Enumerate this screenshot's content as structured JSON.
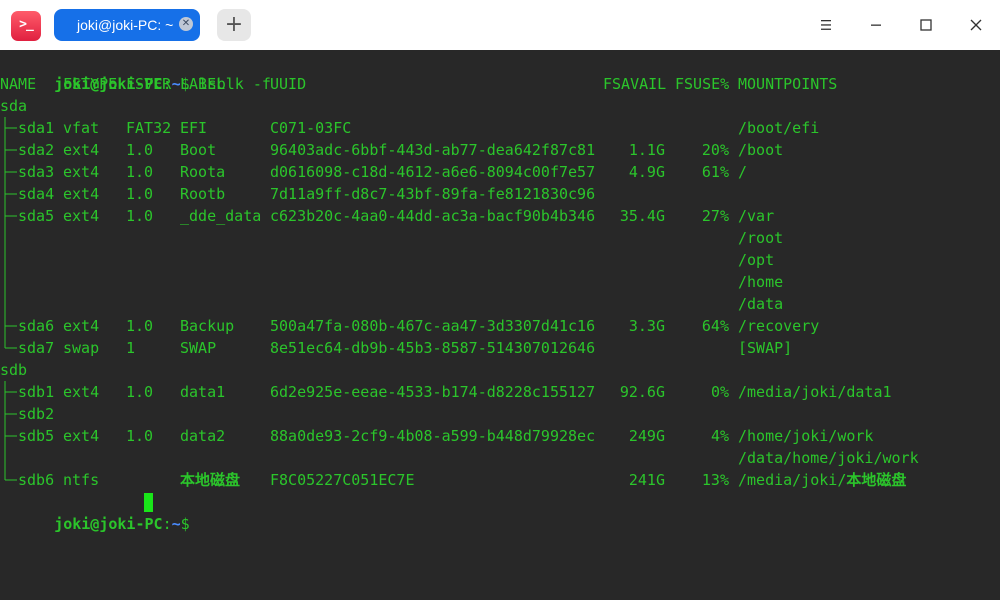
{
  "window": {
    "tab_title": "joki@joki-PC: ~",
    "new_tab_label": "+",
    "app_icon_glyph": ">_",
    "icons": [
      "terminal-app-icon",
      "close-tab-icon",
      "plus-icon",
      "menu-icon",
      "minimize-icon",
      "maximize-icon",
      "close-icon"
    ]
  },
  "colors": {
    "terminal_bg": "#282828",
    "text_green": "#2bc52b",
    "path_blue": "#4a8cff",
    "tab_blue": "#1670e8",
    "cursor": "#19e619"
  },
  "prompt": {
    "user_host": "joki@joki-PC",
    "colon": ":",
    "path": "~",
    "symbol": "$"
  },
  "command": "lsblk -f",
  "headers": {
    "name": "NAME",
    "fstype": "FSTYPE",
    "fsver": "FSVER",
    "label": "LABEL",
    "uuid": "UUID",
    "fsavail": "FSAVAIL",
    "fsuse": "FSUSE%",
    "mountpoints": "MOUNTPOINTS"
  },
  "rows": [
    {
      "name": "sda",
      "fstype": "",
      "fsver": "",
      "label": "",
      "uuid": "",
      "fsavail": "",
      "fsuse": "",
      "mount": ""
    },
    {
      "name": "sda1",
      "fstype": "vfat",
      "fsver": "FAT32",
      "label": "EFI",
      "uuid": "C071-03FC",
      "fsavail": "",
      "fsuse": "",
      "mount": "/boot/efi"
    },
    {
      "name": "sda2",
      "fstype": "ext4",
      "fsver": "1.0",
      "label": "Boot",
      "uuid": "96403adc-6bbf-443d-ab77-dea642f87c81",
      "fsavail": "1.1G",
      "fsuse": "20%",
      "mount": "/boot"
    },
    {
      "name": "sda3",
      "fstype": "ext4",
      "fsver": "1.0",
      "label": "Roota",
      "uuid": "d0616098-c18d-4612-a6e6-8094c00f7e57",
      "fsavail": "4.9G",
      "fsuse": "61%",
      "mount": "/"
    },
    {
      "name": "sda4",
      "fstype": "ext4",
      "fsver": "1.0",
      "label": "Rootb",
      "uuid": "7d11a9ff-d8c7-43bf-89fa-fe8121830c96",
      "fsavail": "",
      "fsuse": "",
      "mount": ""
    },
    {
      "name": "sda5",
      "fstype": "ext4",
      "fsver": "1.0",
      "label": "_dde_data",
      "uuid": "c623b20c-4aa0-44dd-ac3a-bacf90b4b346",
      "fsavail": "35.4G",
      "fsuse": "27%",
      "mount": "/var"
    },
    {
      "name": "",
      "fstype": "",
      "fsver": "",
      "label": "",
      "uuid": "",
      "fsavail": "",
      "fsuse": "",
      "mount": "/root"
    },
    {
      "name": "",
      "fstype": "",
      "fsver": "",
      "label": "",
      "uuid": "",
      "fsavail": "",
      "fsuse": "",
      "mount": "/opt"
    },
    {
      "name": "",
      "fstype": "",
      "fsver": "",
      "label": "",
      "uuid": "",
      "fsavail": "",
      "fsuse": "",
      "mount": "/home"
    },
    {
      "name": "",
      "fstype": "",
      "fsver": "",
      "label": "",
      "uuid": "",
      "fsavail": "",
      "fsuse": "",
      "mount": "/data"
    },
    {
      "name": "sda6",
      "fstype": "ext4",
      "fsver": "1.0",
      "label": "Backup",
      "uuid": "500a47fa-080b-467c-aa47-3d3307d41c16",
      "fsavail": "3.3G",
      "fsuse": "64%",
      "mount": "/recovery"
    },
    {
      "name": "sda7",
      "fstype": "swap",
      "fsver": "1",
      "label": "SWAP",
      "uuid": "8e51ec64-db9b-45b3-8587-514307012646",
      "fsavail": "",
      "fsuse": "",
      "mount": "[SWAP]"
    },
    {
      "name": "sdb",
      "fstype": "",
      "fsver": "",
      "label": "",
      "uuid": "",
      "fsavail": "",
      "fsuse": "",
      "mount": ""
    },
    {
      "name": "sdb1",
      "fstype": "ext4",
      "fsver": "1.0",
      "label": "data1",
      "uuid": "6d2e925e-eeae-4533-b174-d8228c155127",
      "fsavail": "92.6G",
      "fsuse": "0%",
      "mount": "/media/joki/data1"
    },
    {
      "name": "sdb2",
      "fstype": "",
      "fsver": "",
      "label": "",
      "uuid": "",
      "fsavail": "",
      "fsuse": "",
      "mount": ""
    },
    {
      "name": "sdb5",
      "fstype": "ext4",
      "fsver": "1.0",
      "label": "data2",
      "uuid": "88a0de93-2cf9-4b08-a599-b448d79928ec",
      "fsavail": "249G",
      "fsuse": "4%",
      "mount": "/home/joki/work"
    },
    {
      "name": "",
      "fstype": "",
      "fsver": "",
      "label": "",
      "uuid": "",
      "fsavail": "",
      "fsuse": "",
      "mount": "/data/home/joki/work"
    },
    {
      "name": "sdb6",
      "fstype": "ntfs",
      "fsver": "",
      "label": "本地磁盘",
      "uuid": "F8C05227C051EC7E",
      "fsavail": "241G",
      "fsuse": "13%",
      "mount_prefix": "/media/joki/",
      "mount_suffix": "本地磁盘"
    }
  ]
}
